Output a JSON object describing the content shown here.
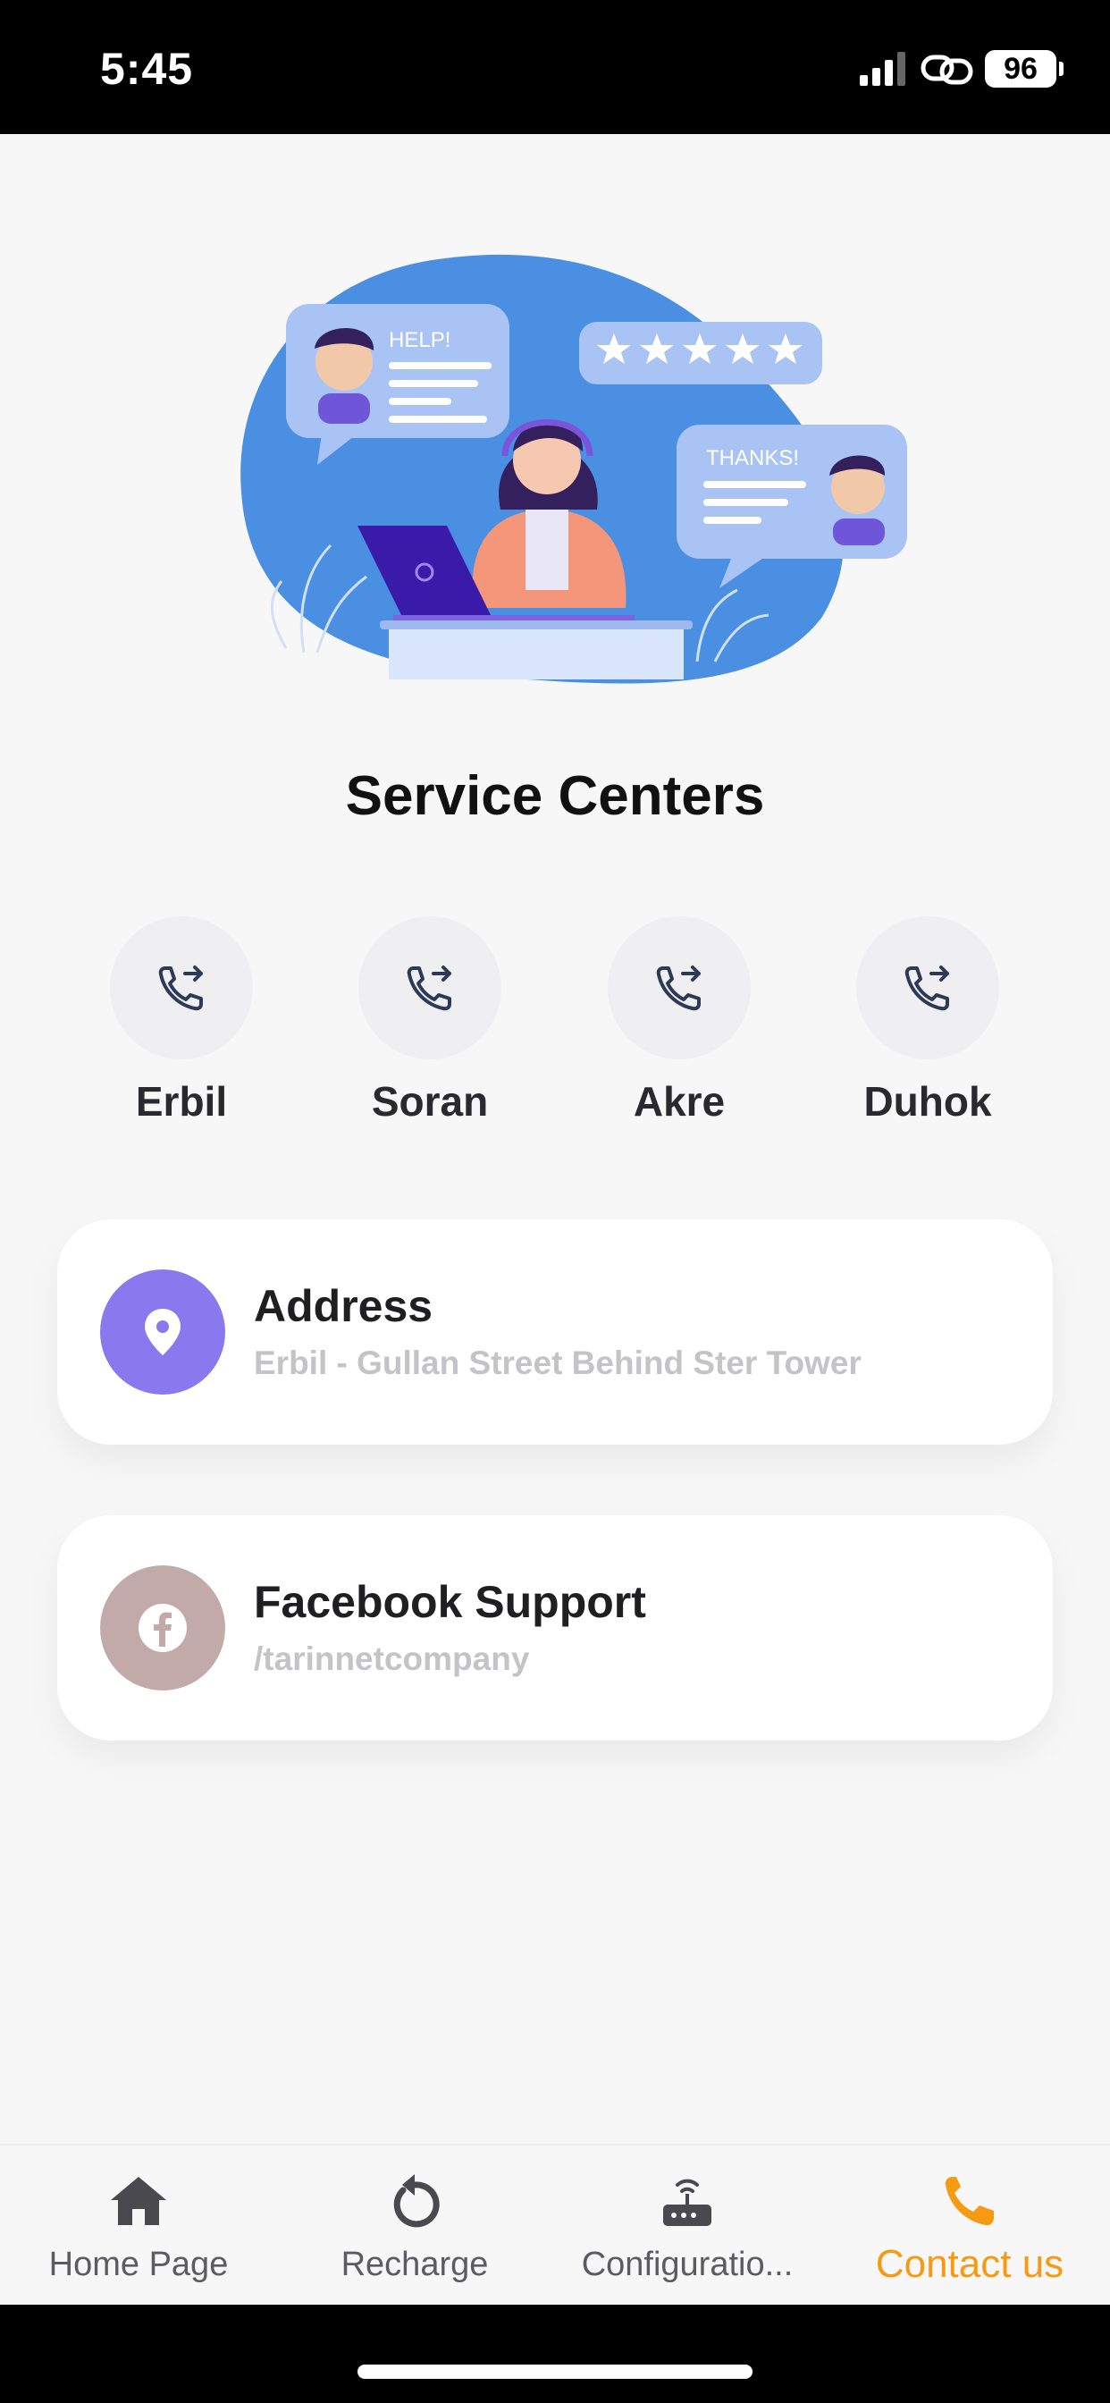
{
  "status_bar": {
    "time": "5:45",
    "battery": "96"
  },
  "hero": {
    "help_text": "HELP!",
    "thanks_text": "THANKS!"
  },
  "title": "Service Centers",
  "centers": [
    {
      "label": "Erbil"
    },
    {
      "label": "Soran"
    },
    {
      "label": "Akre"
    },
    {
      "label": "Duhok"
    }
  ],
  "address_card": {
    "title": "Address",
    "subtitle": "Erbil - Gullan Street Behind Ster Tower",
    "icon": "location-pin-icon",
    "icon_color": "#8a78ee"
  },
  "facebook_card": {
    "title": "Facebook Support",
    "subtitle": "/tarinnetcompany",
    "icon": "facebook-icon",
    "icon_color": "#c2aaa8"
  },
  "bottom_nav": {
    "items": [
      {
        "label": "Home Page",
        "icon": "home-icon"
      },
      {
        "label": "Recharge",
        "icon": "recharge-icon"
      },
      {
        "label": "Configuratio...",
        "icon": "router-icon"
      },
      {
        "label": "Contact us",
        "icon": "phone-icon",
        "active": true
      }
    ],
    "active_color": "#f59a12"
  }
}
